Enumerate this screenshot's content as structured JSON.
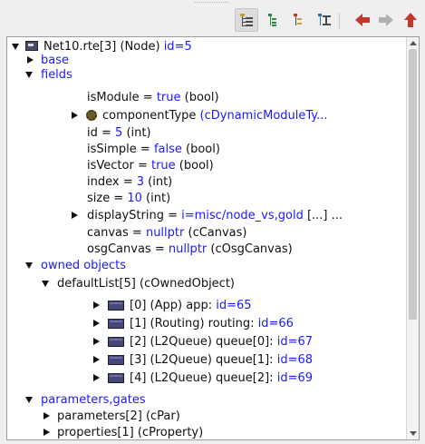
{
  "toolbar": {
    "buttons": [
      {
        "name": "tree-view-icon",
        "active": true
      },
      {
        "name": "flat-view-icon",
        "active": false
      },
      {
        "name": "children-view-icon",
        "active": false
      },
      {
        "name": "grouped-view-icon",
        "active": false
      }
    ],
    "nav": [
      "back-arrow-icon",
      "forward-arrow-icon",
      "up-arrow-icon"
    ]
  },
  "tree": {
    "root": {
      "a": "Net10.rte[3] (Node) ",
      "b": "id=5"
    },
    "base": {
      "a": "base"
    },
    "fields": {
      "a": "fields"
    },
    "isModule": {
      "a": "isModule = ",
      "b": "true",
      "c": " (bool)"
    },
    "componentType": {
      "a": "componentType ",
      "b": "(cDynamicModuleTy..."
    },
    "id": {
      "a": "id = ",
      "b": "5",
      "c": " (int)"
    },
    "isSimple": {
      "a": "isSimple = ",
      "b": "false",
      "c": " (bool)"
    },
    "isVector": {
      "a": "isVector = ",
      "b": "true",
      "c": " (bool)"
    },
    "index": {
      "a": "index = ",
      "b": "3",
      "c": " (int)"
    },
    "size": {
      "a": "size = ",
      "b": "10",
      "c": " (int)"
    },
    "displayString": {
      "a": "displayString = ",
      "b": "i=misc/node_vs,gold",
      "c": " [...] ..."
    },
    "canvas": {
      "a": "canvas = ",
      "b": "nullptr",
      "c": " (cCanvas)"
    },
    "osgCanvas": {
      "a": "osgCanvas = ",
      "b": "nullptr",
      "c": " (cOsgCanvas)"
    },
    "ownedObjects": {
      "a": "owned objects"
    },
    "defaultList": {
      "a": "defaultList[5] (cOwnedObject)"
    },
    "obj0": {
      "a": "[0] (App) app: ",
      "b": "id=65"
    },
    "obj1": {
      "a": "[1] (Routing) routing: ",
      "b": "id=66"
    },
    "obj2": {
      "a": "[2] (L2Queue) queue[0]: ",
      "b": "id=67"
    },
    "obj3": {
      "a": "[3] (L2Queue) queue[1]: ",
      "b": "id=68"
    },
    "obj4": {
      "a": "[4] (L2Queue) queue[2]: ",
      "b": "id=69"
    },
    "parametersGates": {
      "a": "parameters,gates"
    },
    "parameters": {
      "a": "parameters[2] (cPar)"
    },
    "properties": {
      "a": "properties[1] (cProperty)"
    }
  },
  "colors": {
    "link": "#1a1aff",
    "back_arrow": "#c0392b",
    "forward_arrow": "#b0b0b0",
    "up_arrow": "#c0392b"
  }
}
